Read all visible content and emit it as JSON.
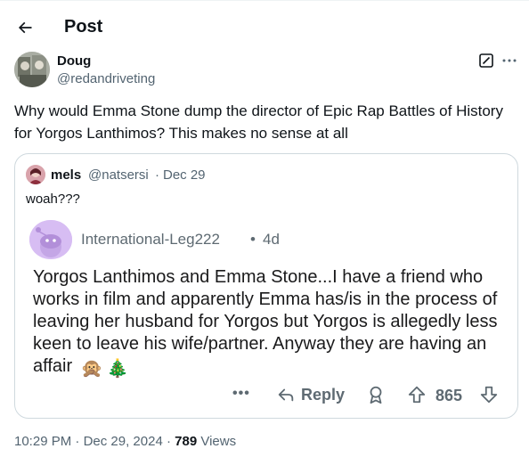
{
  "header": {
    "title": "Post"
  },
  "post": {
    "author_name": "Doug",
    "author_handle": "@redandriveting",
    "text": "Why would Emma Stone dump the director of Epic Rap Battles of History for Yorgos Lanthimos? This makes no sense at all",
    "time": "10:29 PM",
    "date": "Dec 29, 2024",
    "separator": "·",
    "views_count": "789",
    "views_label": "Views"
  },
  "quote": {
    "author_name": "mels",
    "author_handle": "@natsersi",
    "separator": "·",
    "date": "Dec 29",
    "text": "woah???",
    "reddit": {
      "username": "International-Leg222",
      "separator": "•",
      "age": "4d",
      "body": "Yorgos Lanthimos and Emma Stone...I have a friend who works in film and apparently Emma has/is in the process of leaving her husband for Yorgos but Yorgos is allegedly less keen to leave his wife/partner. Anyway they are having an affair",
      "emoji_1": "🙊",
      "emoji_2": "🎄",
      "more_label": "•••",
      "reply_label": "Reply",
      "score": "865"
    }
  },
  "icons": [
    "back-arrow-icon",
    "grok-icon",
    "more-icon",
    "reply-arrow-icon",
    "award-icon",
    "upvote-icon",
    "downvote-icon"
  ],
  "colors": {
    "text": "#0f1419",
    "secondary": "#536471",
    "border": "#cfd9de",
    "reddit_meta": "#5e6a72",
    "snoo_background": "#d7bdf3"
  }
}
